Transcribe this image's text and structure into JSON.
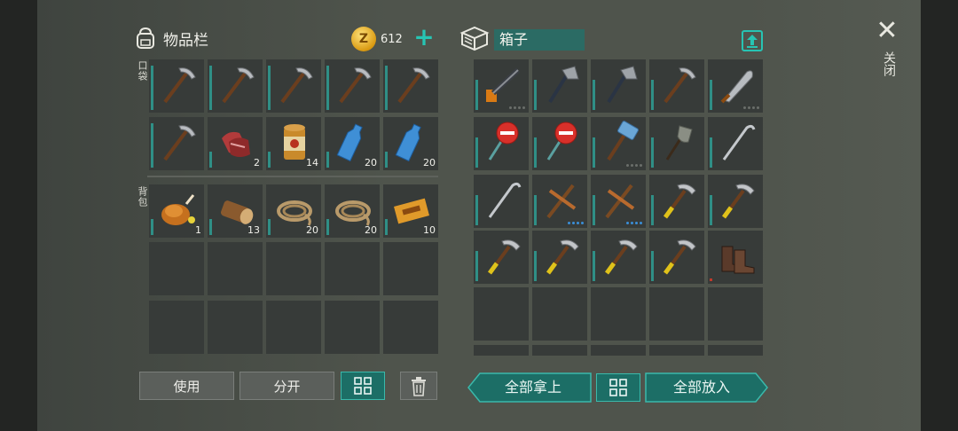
{
  "inventory": {
    "title": "物品栏",
    "coins": "612",
    "pocket_label": "口袋",
    "backpack_label": "背包",
    "pocket_slots": [
      {
        "icon": "pickaxe-icon",
        "count": ""
      },
      {
        "icon": "pickaxe-icon",
        "count": ""
      },
      {
        "icon": "pickaxe-icon",
        "count": ""
      },
      {
        "icon": "pickaxe-icon",
        "count": ""
      },
      {
        "icon": "pickaxe-icon",
        "count": ""
      },
      {
        "icon": "pickaxe-icon",
        "count": ""
      },
      {
        "icon": "raw-meat-icon",
        "count": "2"
      },
      {
        "icon": "canned-food-icon",
        "count": "14"
      },
      {
        "icon": "water-bottle-icon",
        "count": "20"
      },
      {
        "icon": "water-bottle-icon",
        "count": "20"
      }
    ],
    "backpack_slots": [
      {
        "icon": "roast-chicken-icon",
        "count": "1"
      },
      {
        "icon": "wood-log-icon",
        "count": "13"
      },
      {
        "icon": "rope-icon",
        "count": "20"
      },
      {
        "icon": "rope-icon",
        "count": "20"
      },
      {
        "icon": "coupon-icon",
        "count": "10"
      }
    ],
    "buttons": {
      "use": "使用",
      "split": "分开"
    }
  },
  "box": {
    "title": "箱子",
    "slots": [
      {
        "icon": "chainsaw-icon",
        "count": ""
      },
      {
        "icon": "hatchet-icon",
        "count": ""
      },
      {
        "icon": "hatchet-icon",
        "count": ""
      },
      {
        "icon": "pickaxe-icon",
        "count": ""
      },
      {
        "icon": "machete-icon",
        "count": ""
      },
      {
        "icon": "stop-sign-axe-icon",
        "count": ""
      },
      {
        "icon": "stop-sign-axe-icon",
        "count": ""
      },
      {
        "icon": "sledgehammer-icon",
        "count": ""
      },
      {
        "icon": "shovel-icon",
        "count": ""
      },
      {
        "icon": "crowbar-icon",
        "count": ""
      },
      {
        "icon": "crowbar-icon",
        "count": ""
      },
      {
        "icon": "copper-pickaxe-icon",
        "count": ""
      },
      {
        "icon": "copper-pickaxe-icon",
        "count": ""
      },
      {
        "icon": "yellow-pickaxe-icon",
        "count": ""
      },
      {
        "icon": "yellow-pickaxe-icon",
        "count": ""
      },
      {
        "icon": "yellow-pickaxe-icon",
        "count": ""
      },
      {
        "icon": "yellow-pickaxe-icon",
        "count": ""
      },
      {
        "icon": "yellow-pickaxe-icon",
        "count": ""
      },
      {
        "icon": "yellow-pickaxe-icon",
        "count": ""
      },
      {
        "icon": "boots-icon",
        "count": ""
      }
    ],
    "buttons": {
      "take_all": "全部拿上",
      "put_all": "全部放入"
    }
  },
  "close_label": "关闭",
  "colors": {
    "accent": "#27c4b3",
    "slot": "#373b39",
    "backdrop": "#4f544c"
  }
}
